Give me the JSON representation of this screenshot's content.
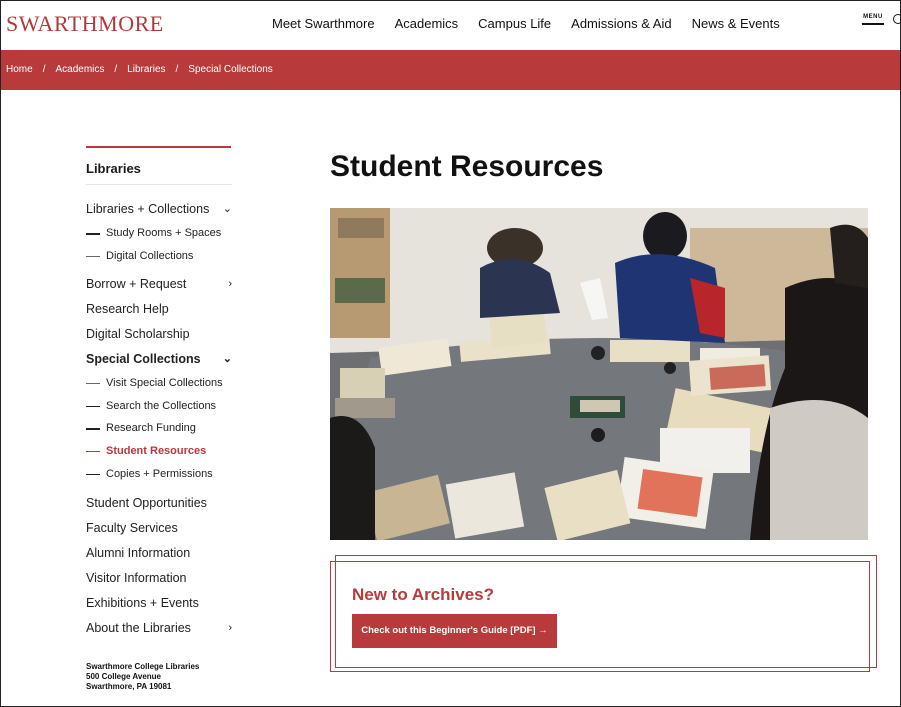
{
  "header": {
    "logo": "SWARTHMORE",
    "nav": [
      "Meet Swarthmore",
      "Academics",
      "Campus Life",
      "Admissions & Aid",
      "News & Events"
    ],
    "menu_label": "MENU"
  },
  "breadcrumb": [
    "Home",
    "Academics",
    "Libraries",
    "Special Collections"
  ],
  "breadcrumb_separator": "/",
  "sidebar": {
    "heading": "Libraries",
    "items": [
      {
        "label": "Libraries + Collections",
        "chevron": "chevron-down-icon"
      },
      {
        "label": "Study Rooms + Spaces"
      },
      {
        "label": "Digital Collections"
      },
      {
        "label": "Borrow + Request",
        "chevron": "chevron-right-icon"
      },
      {
        "label": "Research Help"
      },
      {
        "label": "Digital Scholarship"
      },
      {
        "label": "Special Collections",
        "chevron": "chevron-down-icon"
      },
      {
        "label": "Visit Special Collections"
      },
      {
        "label": "Search the Collections"
      },
      {
        "label": "Research Funding"
      },
      {
        "label": "Student Resources"
      },
      {
        "label": "Copies + Permissions"
      },
      {
        "label": "Student Opportunities"
      },
      {
        "label": "Faculty Services"
      },
      {
        "label": "Alumni Information"
      },
      {
        "label": "Visitor Information"
      },
      {
        "label": "Exhibitions + Events"
      },
      {
        "label": "About the Libraries",
        "chevron": "chevron-right-icon"
      }
    ],
    "address": [
      "Swarthmore College Libraries",
      "500 College Avenue",
      "Swarthmore, PA 19081"
    ]
  },
  "main": {
    "title": "Student Resources",
    "callout_title": "New to Archives?",
    "callout_button": "Check out this Beginner's Guide [PDF] →"
  },
  "colors": {
    "brand_red": "#b83a3a",
    "text": "#1a1a1a"
  },
  "glyphs": {
    "chevron_down": "⌄",
    "chevron_right": "›"
  }
}
